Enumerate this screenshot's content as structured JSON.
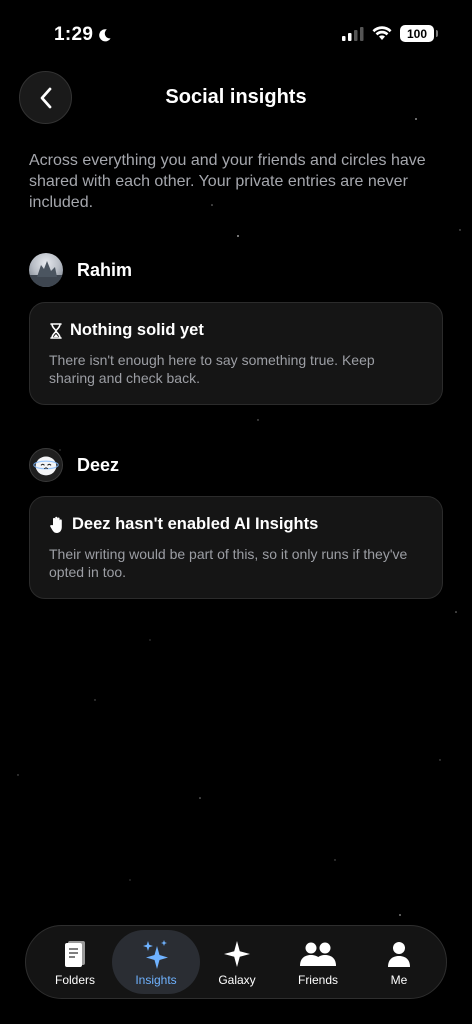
{
  "status_bar": {
    "time": "1:29",
    "battery": "100"
  },
  "header": {
    "title": "Social insights"
  },
  "intro": "Across everything you and your friends and circles have shared with each other. Your private entries are never included.",
  "people": [
    {
      "name": "Rahim",
      "card": {
        "icon": "hourglass-icon",
        "title": "Nothing solid yet",
        "body": "There isn't enough here to say something true. Keep sharing and check back."
      }
    },
    {
      "name": "Deez",
      "card": {
        "icon": "raised-hand-icon",
        "title": "Deez hasn't enabled AI Insights",
        "body": "Their writing would be part of this, so it only runs if they've opted in too."
      }
    }
  ],
  "tabs": [
    {
      "label": "Folders",
      "icon": "notebook-icon",
      "active": false
    },
    {
      "label": "Insights",
      "icon": "sparkles-icon",
      "active": true
    },
    {
      "label": "Galaxy",
      "icon": "star-icon",
      "active": false
    },
    {
      "label": "Friends",
      "icon": "people-icon",
      "active": false
    },
    {
      "label": "Me",
      "icon": "person-icon",
      "active": false
    }
  ],
  "colors": {
    "background": "#000000",
    "accent": "#6fb2ff",
    "card": "#151515"
  }
}
